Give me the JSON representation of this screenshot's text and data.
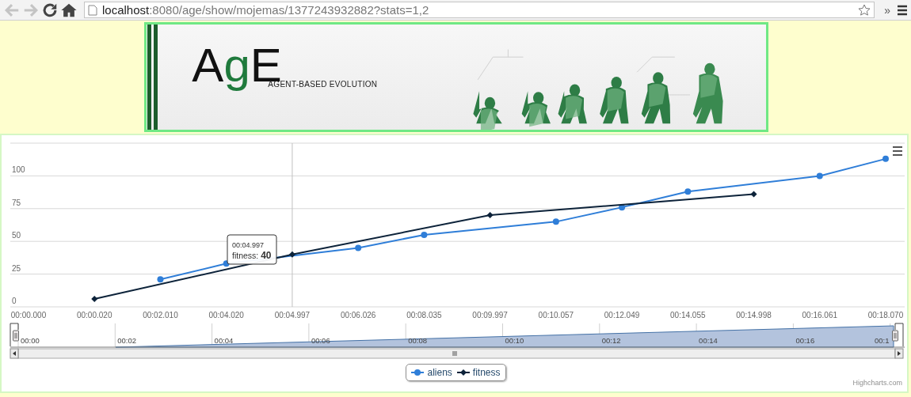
{
  "browser": {
    "address": {
      "host": "localhost",
      "path": ":8080/age/show/mojemas/1377243932882?stats=1,2"
    },
    "overflow": "»"
  },
  "banner": {
    "logo_letters": [
      {
        "text": "A",
        "color": "#111111"
      },
      {
        "text": "g",
        "color": "#1f7a3c"
      },
      {
        "text": "E",
        "color": "#111111"
      }
    ],
    "tagline": "AGENT-BASED EVOLUTION"
  },
  "chart": {
    "chart_data": {
      "type": "line",
      "categories": [
        "00:00.000",
        "00:00.020",
        "00:02.010",
        "00:04.020",
        "00:04.997",
        "00:06.026",
        "00:08.035",
        "00:09.997",
        "00:10.057",
        "00:12.049",
        "00:14.055",
        "00:14.998",
        "00:16.061",
        "00:18.070"
      ],
      "ylim": [
        0,
        125
      ],
      "yticks": [
        0,
        25,
        50,
        75,
        100
      ],
      "grid": true,
      "ref_lines": [
        {
          "axis": "x",
          "value": "00:04.997"
        }
      ],
      "series": [
        {
          "name": "aliens",
          "color": "#2f7ed8",
          "marker": "circle",
          "values": [
            null,
            null,
            21,
            33,
            null,
            45,
            55,
            null,
            65,
            76,
            88,
            null,
            100,
            113
          ]
        },
        {
          "name": "fitness",
          "color": "#0d233a",
          "marker": "diamond",
          "values": [
            null,
            6,
            null,
            null,
            40,
            null,
            null,
            70,
            null,
            null,
            null,
            86,
            null,
            null
          ]
        }
      ]
    },
    "tooltip": {
      "title": "00:04.997",
      "label": "fitness:",
      "value": "40"
    },
    "navigator": {
      "labels": [
        "00:00",
        "00:02",
        "00:04",
        "00:06",
        "00:08",
        "00:10",
        "00:12",
        "00:14",
        "00:16",
        "00:1"
      ]
    },
    "credits": "Highcharts.com"
  }
}
